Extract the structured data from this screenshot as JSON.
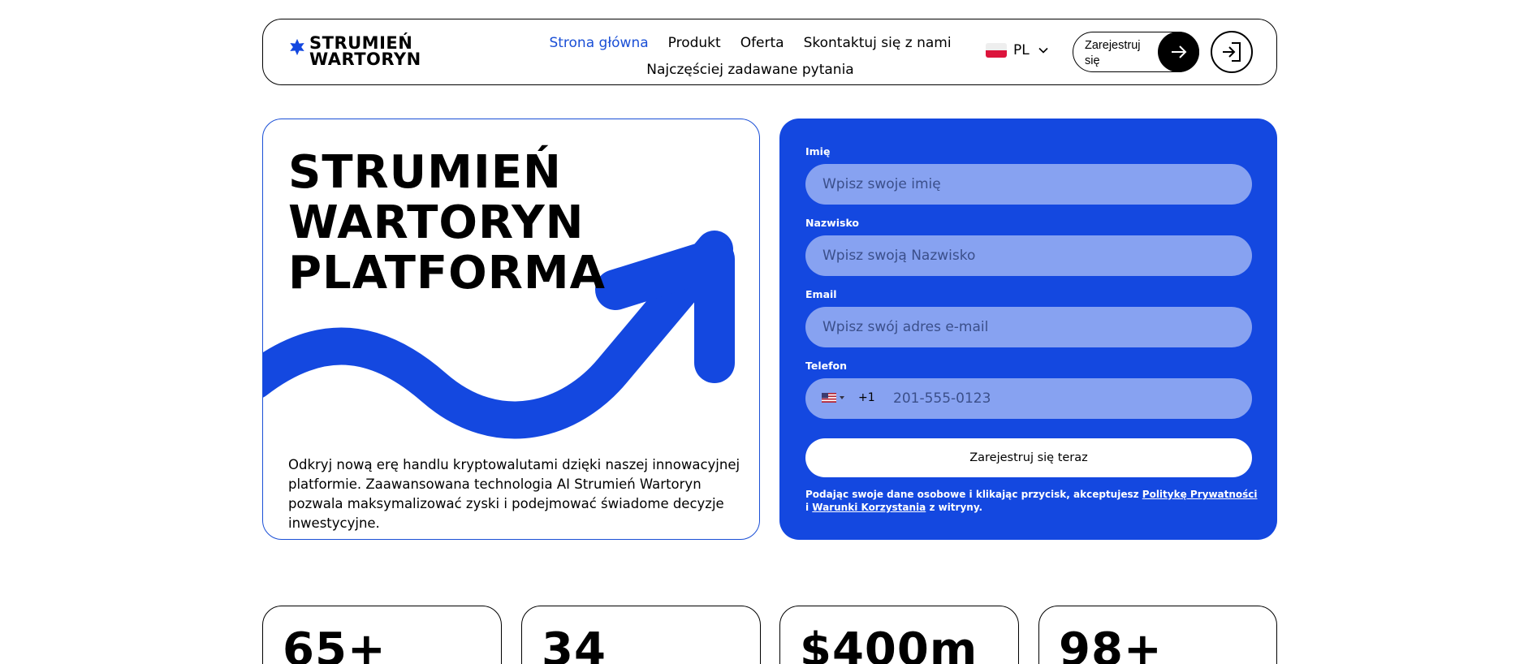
{
  "header": {
    "logo_line1": "STRUMIEŃ",
    "logo_line2": "WARTORYN",
    "nav": [
      {
        "label": "Strona główna",
        "active": true
      },
      {
        "label": "Produkt"
      },
      {
        "label": "Oferta"
      },
      {
        "label": "Skontaktuj się z nami"
      },
      {
        "label": "Najczęściej zadawane pytania"
      }
    ],
    "language": "PL",
    "register_label": "Zarejestruj się",
    "icons": {
      "logo": "star-icon",
      "lang": "chevron-down-icon",
      "register": "arrow-right-icon",
      "login": "login-icon"
    }
  },
  "hero": {
    "title_line1": "STRUMIEŃ",
    "title_line2": "WARTORYN",
    "title_line3": "PLATFORMA",
    "description": "Odkryj nową erę handlu kryptowalutami dzięki naszej innowacyjnej platformie. Zaawansowana technologia AI Strumień Wartoryn pozwala maksymalizować zyski i podejmować świadome decyzje inwestycyjne."
  },
  "form": {
    "first_name_label": "Imię",
    "first_name_placeholder": "Wpisz swoje imię",
    "last_name_label": "Nazwisko",
    "last_name_placeholder": "Wpisz swoją Nazwisko",
    "email_label": "Email",
    "email_placeholder": "Wpisz swój adres e-mail",
    "phone_label": "Telefon",
    "phone_dial_code": "+1",
    "phone_placeholder": "201-555-0123",
    "submit_label": "Zarejestruj się teraz",
    "consent_prefix": "Podając swoje dane osobowe i klikając przycisk, akceptujesz ",
    "privacy_link": "Politykę Prywatności",
    "consent_and": " i ",
    "terms_link": "Warunki Korzystania",
    "consent_suffix": " z witryny."
  },
  "stats": [
    "65+",
    "34",
    "$400m",
    "98+"
  ],
  "colors": {
    "accent": "#1448e0",
    "field": "#87a2f1"
  }
}
